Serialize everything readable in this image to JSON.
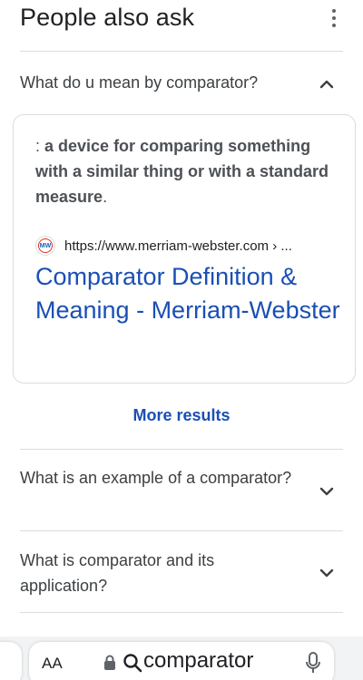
{
  "header": {
    "title": "People also ask",
    "menu_icon": "more-vert-icon"
  },
  "questions": [
    {
      "text": "What do u mean by comparator?",
      "expanded": true,
      "chevron": "chevron-up-icon"
    },
    {
      "text": "What is an example of a comparator?",
      "expanded": false,
      "chevron": "chevron-down-icon"
    },
    {
      "text": "What is comparator and its application?",
      "expanded": false,
      "chevron": "chevron-down-icon"
    }
  ],
  "answer": {
    "prefix": ": ",
    "snippet": "a device for comparing something with a similar thing or with a standard measure",
    "suffix": ".",
    "favicon_text": "MW",
    "source_url": "https://www.merriam-webster.com › ...",
    "result_title": "Comparator Definition & Meaning - Merriam-Webster"
  },
  "more_results_label": "More results",
  "address_bar": {
    "text_size_label": "AA",
    "query": "comparator",
    "icons": [
      "lock-icon",
      "search-icon",
      "microphone-icon"
    ]
  },
  "colors": {
    "link_blue": "#1a4fb4",
    "text_dark": "#202124",
    "text_body": "#4d5156",
    "divider": "#dadce0"
  }
}
